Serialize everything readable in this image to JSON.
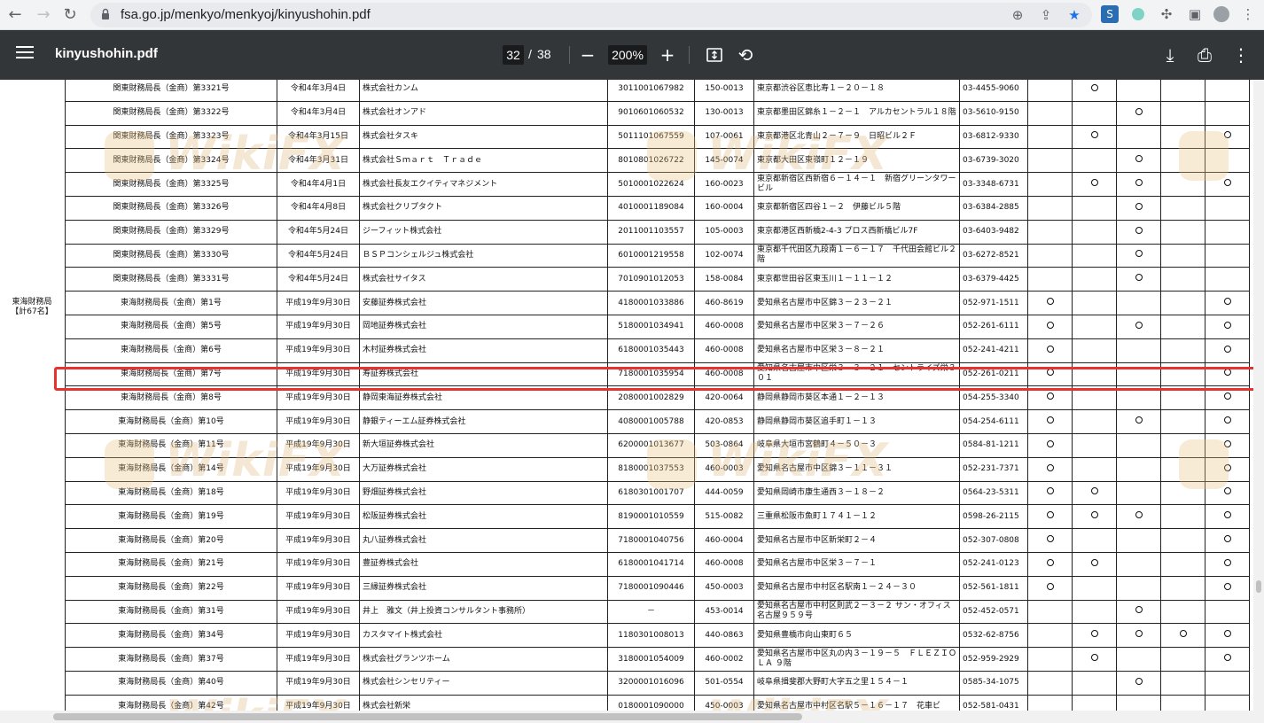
{
  "browser": {
    "url": "fsa.go.jp/menkyo/menkyoj/kinyushohin.pdf"
  },
  "pdf_viewer": {
    "title": "kinyushohin.pdf",
    "current_page": "32",
    "page_separator": "/",
    "total_pages": "38",
    "zoom": "200%"
  },
  "region_label": "東海財務局\n【計67名】",
  "watermark_text": "WikiFX",
  "rows": [
    {
      "reg": "関東財務局長（金商）第3321号",
      "date": "令和4年3月4日",
      "name": "株式会社カンム",
      "corp_no": "3011001067982",
      "zip": "150-0013",
      "addr": "東京都渋谷区恵比寿１－２０－１８",
      "tel": "03-4455-9060",
      "marks": [
        false,
        true,
        false,
        false,
        false
      ]
    },
    {
      "reg": "関東財務局長（金商）第3322号",
      "date": "令和4年3月4日",
      "name": "株式会社オンアド",
      "corp_no": "9010601060532",
      "zip": "130-0013",
      "addr": "東京都墨田区錦糸１－２－１　アルカセントラル１８階",
      "tel": "03-5610-9150",
      "marks": [
        false,
        false,
        true,
        false,
        false
      ]
    },
    {
      "reg": "関東財務局長（金商）第3323号",
      "date": "令和4年3月15日",
      "name": "株式会社タスキ",
      "corp_no": "5011101067559",
      "zip": "107-0061",
      "addr": "東京都港区北青山２－７－９　日昭ビル２Ｆ",
      "tel": "03-6812-9330",
      "marks": [
        false,
        true,
        false,
        false,
        true
      ]
    },
    {
      "reg": "関東財務局長（金商）第3324号",
      "date": "令和4年3月31日",
      "name": "株式会社Ｓｍａｒｔ　Ｔｒａｄｅ",
      "corp_no": "8010801026722",
      "zip": "145-0074",
      "addr": "東京都大田区東嶺町１２－１９",
      "tel": "03-6739-3020",
      "marks": [
        false,
        false,
        true,
        false,
        false
      ]
    },
    {
      "reg": "関東財務局長（金商）第3325号",
      "date": "令和4年4月1日",
      "name": "株式会社長友エクイティマネジメント",
      "corp_no": "5010001022624",
      "zip": "160-0023",
      "addr": "東京都新宿区西新宿６－１４－１　新宿グリーンタワービル",
      "tel": "03-3348-6731",
      "marks": [
        false,
        true,
        true,
        false,
        true
      ]
    },
    {
      "reg": "関東財務局長（金商）第3326号",
      "date": "令和4年4月8日",
      "name": "株式会社クリプタクト",
      "corp_no": "4010001189084",
      "zip": "160-0004",
      "addr": "東京都新宿区四谷１－２　伊藤ビル５階",
      "tel": "03-6384-2885",
      "marks": [
        false,
        false,
        true,
        false,
        false
      ]
    },
    {
      "reg": "関東財務局長（金商）第3329号",
      "date": "令和4年5月24日",
      "name": "ジーフィット株式会社",
      "corp_no": "2011001103557",
      "zip": "105-0003",
      "addr": "東京都港区西新橋2-4-3 プロス西新橋ビル7F",
      "tel": "03-6403-9482",
      "marks": [
        false,
        false,
        true,
        false,
        false
      ]
    },
    {
      "reg": "関東財務局長（金商）第3330号",
      "date": "令和4年5月24日",
      "name": "ＢＳＰコンシェルジュ株式会社",
      "corp_no": "6010001219558",
      "zip": "102-0074",
      "addr": "東京都千代田区九段南１－６－１７　千代田会館ビル２階",
      "tel": "03-6272-8521",
      "marks": [
        false,
        false,
        true,
        false,
        false
      ]
    },
    {
      "reg": "関東財務局長（金商）第3331号",
      "date": "令和4年5月24日",
      "name": "株式会社サイタス",
      "corp_no": "7010901012053",
      "zip": "158-0084",
      "addr": "東京都世田谷区東玉川１－１１－１２",
      "tel": "03-6379-4425",
      "marks": [
        false,
        false,
        true,
        false,
        false
      ]
    },
    {
      "reg": "東海財務局長（金商）第1号",
      "date": "平成19年9月30日",
      "name": "安藤証券株式会社",
      "corp_no": "4180001033886",
      "zip": "460-8619",
      "addr": "愛知県名古屋市中区錦３－２３－２１",
      "tel": "052-971-1511",
      "marks": [
        true,
        false,
        false,
        false,
        true
      ]
    },
    {
      "reg": "東海財務局長（金商）第5号",
      "date": "平成19年9月30日",
      "name": "岡地証券株式会社",
      "corp_no": "5180001034941",
      "zip": "460-0008",
      "addr": "愛知県名古屋市中区栄３－７－２６",
      "tel": "052-261-6111",
      "marks": [
        true,
        false,
        true,
        false,
        true
      ]
    },
    {
      "reg": "東海財務局長（金商）第6号",
      "date": "平成19年9月30日",
      "name": "木村証券株式会社",
      "corp_no": "6180001035443",
      "zip": "460-0008",
      "addr": "愛知県名古屋市中区栄３－８－２１",
      "tel": "052-241-4211",
      "marks": [
        true,
        false,
        false,
        false,
        true
      ]
    },
    {
      "reg": "東海財務局長（金商）第7号",
      "date": "平成19年9月30日",
      "name": "寿証券株式会社",
      "corp_no": "7180001035954",
      "zip": "460-0008",
      "addr": "愛知県名古屋市中区栄３－３－２１　セントライズ栄３０１",
      "tel": "052-261-0211",
      "marks": [
        true,
        false,
        false,
        false,
        true
      ]
    },
    {
      "reg": "東海財務局長（金商）第8号",
      "date": "平成19年9月30日",
      "name": "静岡東海証券株式会社",
      "corp_no": "2080001002829",
      "zip": "420-0064",
      "addr": "静岡県静岡市葵区本通１－２－１３",
      "tel": "054-255-3340",
      "marks": [
        true,
        false,
        false,
        false,
        true
      ]
    },
    {
      "reg": "東海財務局長（金商）第10号",
      "date": "平成19年9月30日",
      "name": "静銀ティーエム証券株式会社",
      "corp_no": "4080001005788",
      "zip": "420-0853",
      "addr": "静岡県静岡市葵区追手町１－１３",
      "tel": "054-254-6111",
      "marks": [
        true,
        false,
        true,
        false,
        true
      ]
    },
    {
      "reg": "東海財務局長（金商）第11号",
      "date": "平成19年9月30日",
      "name": "新大垣証券株式会社",
      "corp_no": "6200001013677",
      "zip": "503-0864",
      "addr": "岐阜県大垣市宮鶴町４－５０－３",
      "tel": "0584-81-1211",
      "marks": [
        true,
        false,
        false,
        false,
        true
      ]
    },
    {
      "reg": "東海財務局長（金商）第14号",
      "date": "平成19年9月30日",
      "name": "大万証券株式会社",
      "corp_no": "8180001037553",
      "zip": "460-0003",
      "addr": "愛知県名古屋市中区錦３－１１－３１",
      "tel": "052-231-7371",
      "marks": [
        true,
        false,
        false,
        false,
        true
      ]
    },
    {
      "reg": "東海財務局長（金商）第18号",
      "date": "平成19年9月30日",
      "name": "野畑証券株式会社",
      "corp_no": "6180301001707",
      "zip": "444-0059",
      "addr": "愛知県岡崎市康生通西３－１８－２",
      "tel": "0564-23-5311",
      "marks": [
        true,
        true,
        false,
        false,
        true
      ]
    },
    {
      "reg": "東海財務局長（金商）第19号",
      "date": "平成19年9月30日",
      "name": "松阪証券株式会社",
      "corp_no": "8190001010559",
      "zip": "515-0082",
      "addr": "三重県松阪市魚町１７４１－１２",
      "tel": "0598-26-2115",
      "marks": [
        true,
        true,
        true,
        false,
        true
      ]
    },
    {
      "reg": "東海財務局長（金商）第20号",
      "date": "平成19年9月30日",
      "name": "丸八証券株式会社",
      "corp_no": "7180001040756",
      "zip": "460-0004",
      "addr": "愛知県名古屋市中区新栄町２－４",
      "tel": "052-307-0808",
      "marks": [
        true,
        false,
        false,
        false,
        true
      ]
    },
    {
      "reg": "東海財務局長（金商）第21号",
      "date": "平成19年9月30日",
      "name": "豊証券株式会社",
      "corp_no": "6180001041714",
      "zip": "460-0008",
      "addr": "愛知県名古屋市中区栄３－７－１",
      "tel": "052-241-0123",
      "marks": [
        true,
        true,
        false,
        false,
        true
      ]
    },
    {
      "reg": "東海財務局長（金商）第22号",
      "date": "平成19年9月30日",
      "name": "三縁証券株式会社",
      "corp_no": "7180001090446",
      "zip": "450-0003",
      "addr": "愛知県名古屋市中村区名駅南１－２４－３０",
      "tel": "052-561-1811",
      "marks": [
        true,
        false,
        false,
        false,
        true
      ]
    },
    {
      "reg": "東海財務局長（金商）第31号",
      "date": "平成19年9月30日",
      "name": "井上　雅文（井上投資コンサルタント事務所）",
      "corp_no": "－",
      "zip": "453-0014",
      "addr": "愛知県名古屋市中村区則武２－３－２ サン・オフィス名古屋９５９号",
      "tel": "052-452-0571",
      "marks": [
        false,
        false,
        true,
        false,
        false
      ]
    },
    {
      "reg": "東海財務局長（金商）第34号",
      "date": "平成19年9月30日",
      "name": "カスタマイト株式会社",
      "corp_no": "1180301008013",
      "zip": "440-0863",
      "addr": "愛知県豊橋市向山東町６５",
      "tel": "0532-62-8756",
      "marks": [
        false,
        true,
        true,
        true,
        true
      ]
    },
    {
      "reg": "東海財務局長（金商）第37号",
      "date": "平成19年9月30日",
      "name": "株式会社グランツホーム",
      "corp_no": "3180001054009",
      "zip": "460-0002",
      "addr": "愛知県名古屋市中区丸の内３－１９－５　ＦＬＥＺＩＯ ＬＡ ９階",
      "tel": "052-959-2929",
      "marks": [
        false,
        true,
        false,
        false,
        true
      ]
    },
    {
      "reg": "東海財務局長（金商）第40号",
      "date": "平成19年9月30日",
      "name": "株式会社シンセリティー",
      "corp_no": "3200001016096",
      "zip": "501-0554",
      "addr": "岐阜県揖斐郡大野町大字五之里１５４－１",
      "tel": "0585-34-1075",
      "marks": [
        false,
        false,
        true,
        false,
        false
      ]
    },
    {
      "reg": "東海財務局長（金商）第42号",
      "date": "平成19年9月30日",
      "name": "株式会社新栄",
      "corp_no": "0180001090000",
      "zip": "450-0003",
      "addr": "愛知県名古屋市中村区名駅５－１６－１７　花車ビ",
      "tel": "052-581-0431",
      "marks": [
        false,
        false,
        false,
        false,
        false
      ]
    }
  ],
  "highlighted_row_index": 12
}
